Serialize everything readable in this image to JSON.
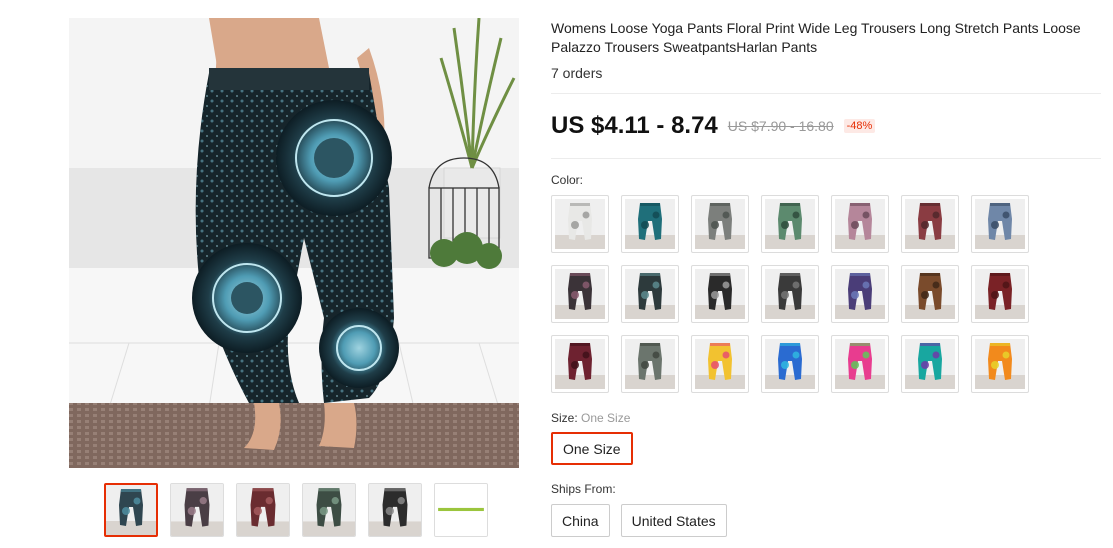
{
  "product": {
    "title": "Womens Loose Yoga Pants Floral Print Wide Leg Trousers Long Stretch Pants Loose Palazzo Trousers SweatpantsHarlan Pants",
    "orders": "7 orders"
  },
  "price": {
    "current": "US $4.11 - 8.74",
    "original": "US $7.90 - 16.80",
    "discount": "-48%"
  },
  "color": {
    "label": "Color:",
    "swatches": [
      {
        "name": "white",
        "colors": [
          "#e8e8e6",
          "#9a9a98"
        ]
      },
      {
        "name": "teal",
        "colors": [
          "#1f6f7a",
          "#134b53"
        ]
      },
      {
        "name": "grey-floral",
        "colors": [
          "#7c7f7c",
          "#4c524f"
        ]
      },
      {
        "name": "green-floral",
        "colors": [
          "#5c8a6e",
          "#2e4b3c"
        ]
      },
      {
        "name": "pink-floral",
        "colors": [
          "#b5869a",
          "#6b4a59"
        ]
      },
      {
        "name": "red-floral",
        "colors": [
          "#8a3c42",
          "#50272a"
        ]
      },
      {
        "name": "blue-floral",
        "colors": [
          "#6f87a8",
          "#3a4c66"
        ]
      },
      {
        "name": "black-pink",
        "colors": [
          "#3b3338",
          "#8a5c70"
        ]
      },
      {
        "name": "black-teal",
        "colors": [
          "#2d3a3c",
          "#5d8b8e"
        ]
      },
      {
        "name": "black-white",
        "colors": [
          "#2a2a2a",
          "#9c9c9c"
        ]
      },
      {
        "name": "black-grey",
        "colors": [
          "#3a3a3a",
          "#777777"
        ]
      },
      {
        "name": "purple-blue",
        "colors": [
          "#4a3d78",
          "#6b79b8"
        ]
      },
      {
        "name": "brown",
        "colors": [
          "#7a4b2c",
          "#3e2718"
        ]
      },
      {
        "name": "dark-red",
        "colors": [
          "#7a2226",
          "#4d1416"
        ]
      },
      {
        "name": "wine",
        "colors": [
          "#6e2230",
          "#3f1119"
        ]
      },
      {
        "name": "grey-green",
        "colors": [
          "#6b756d",
          "#3f4640"
        ]
      },
      {
        "name": "rainbow-yellow",
        "colors": [
          "#f2c230",
          "#e84d6f"
        ]
      },
      {
        "name": "tie-dye-blue",
        "colors": [
          "#2a6bd1",
          "#2fb7e0"
        ]
      },
      {
        "name": "tie-dye-pink",
        "colors": [
          "#e83c8f",
          "#5fc45a"
        ]
      },
      {
        "name": "tie-dye-teal",
        "colors": [
          "#18a7a0",
          "#6e3aa8"
        ]
      },
      {
        "name": "tie-dye-orange",
        "colors": [
          "#f28a1c",
          "#e8d22a"
        ]
      }
    ]
  },
  "size": {
    "label": "Size:",
    "selected": "One Size",
    "option": "One Size"
  },
  "ships": {
    "label": "Ships From:",
    "options": [
      "China",
      "United States"
    ]
  },
  "gallery": {
    "thumbs": [
      {
        "colors": [
          "#2f4650",
          "#4f8ea0"
        ]
      },
      {
        "colors": [
          "#4a3e45",
          "#9a7c8a"
        ]
      },
      {
        "colors": [
          "#6a2c30",
          "#a55c5e"
        ]
      },
      {
        "colors": [
          "#3d4d44",
          "#7a9a86"
        ]
      },
      {
        "colors": [
          "#2c2c2c",
          "#8a8a8a"
        ]
      },
      {
        "colors": [
          "#ffffff",
          "#9bc53d"
        ]
      }
    ]
  },
  "theme": {
    "accent": "#e62e04"
  }
}
